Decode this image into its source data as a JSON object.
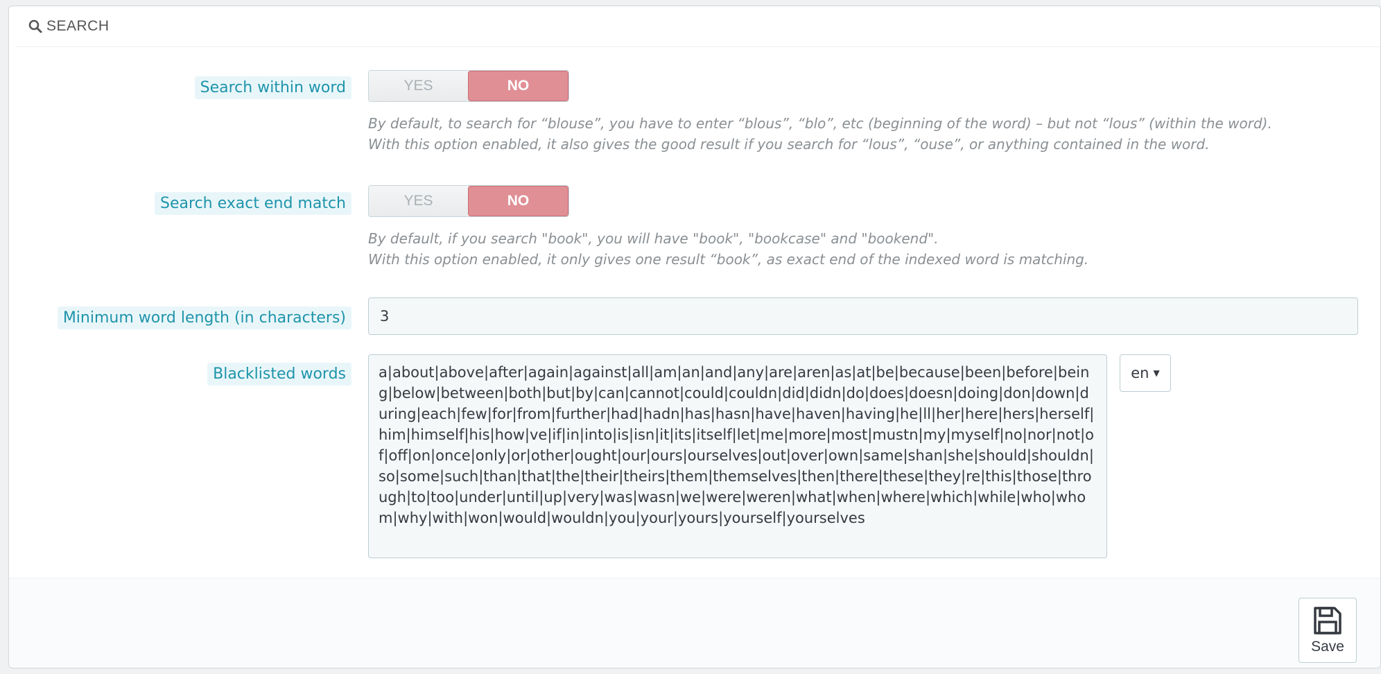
{
  "panel": {
    "title": "SEARCH",
    "title_icon": "search-icon"
  },
  "fields": {
    "search_within_word": {
      "label": "Search within word",
      "yes_label": "YES",
      "no_label": "NO",
      "selected": "NO",
      "help_line1": "By default, to search for “blouse”, you have to enter “blous”, “blo”, etc (beginning of the word) – but not “lous” (within the word).",
      "help_line2": "With this option enabled, it also gives the good result if you search for “lous”, “ouse”, or anything contained in the word."
    },
    "search_exact_end_match": {
      "label": "Search exact end match",
      "yes_label": "YES",
      "no_label": "NO",
      "selected": "NO",
      "help_line1": "By default, if you search \"book\", you will have \"book\", \"bookcase\" and \"bookend\".",
      "help_line2": "With this option enabled, it only gives one result “book”, as exact end of the indexed word is matching."
    },
    "min_word_length": {
      "label": "Minimum word length (in characters)",
      "value": "3"
    },
    "blacklisted_words": {
      "label": "Blacklisted words",
      "value": "a|about|above|after|again|against|all|am|an|and|any|are|aren|as|at|be|because|been|before|being|below|between|both|but|by|can|cannot|could|couldn|did|didn|do|does|doesn|doing|don|down|during|each|few|for|from|further|had|hadn|has|hasn|have|haven|having|he|ll|her|here|hers|herself|him|himself|his|how|ve|if|in|into|is|isn|it|its|itself|let|me|more|most|mustn|my|myself|no|nor|not|of|off|on|once|only|or|other|ought|our|ours|ourselves|out|over|own|same|shan|she|should|shouldn|so|some|such|than|that|the|their|theirs|them|themselves|then|there|these|they|re|this|those|through|to|too|under|until|up|very|was|wasn|we|were|weren|what|when|where|which|while|who|whom|why|with|won|would|wouldn|you|your|yours|yourself|yourselves",
      "language": "en"
    }
  },
  "footer": {
    "save_label": "Save",
    "save_icon": "floppy-disk-icon"
  },
  "colors": {
    "label_text": "#1e94ab",
    "label_bg": "#e9f6f9",
    "toggle_no_bg": "#e08f95",
    "help_text": "#8a8f93"
  }
}
